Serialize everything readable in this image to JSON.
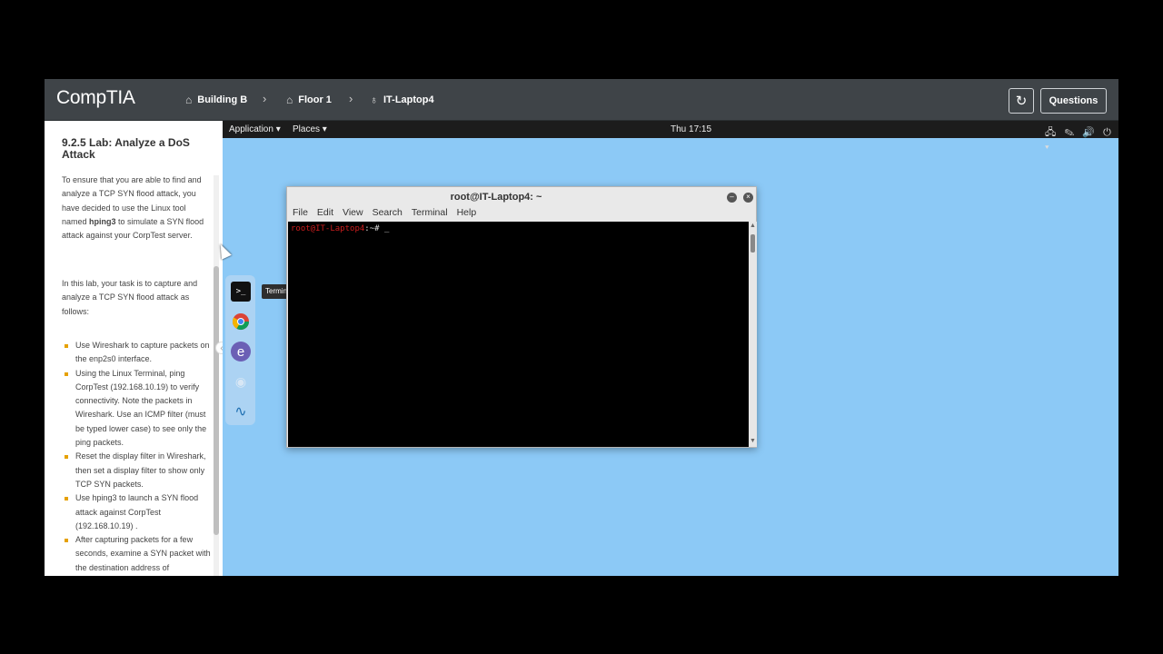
{
  "header": {
    "logo": "CompTIA",
    "breadcrumbs": [
      {
        "label": "Building B",
        "icon": "building-icon"
      },
      {
        "label": "Floor 1",
        "icon": "floor-icon"
      },
      {
        "label": "IT-Laptop4",
        "icon": "laptop-icon"
      }
    ],
    "separator": "›",
    "refresh_icon": "↻",
    "questions_label": "Questions"
  },
  "panel": {
    "title": "9.2.5 Lab: Analyze a DoS Attack",
    "intro_parts": [
      "To ensure that you are able to find and analyze a TCP SYN flood attack, you have decided to use the Linux tool named ",
      "hping3",
      " to simulate a SYN flood attack against your CorpTest server."
    ],
    "task_intro": "In this lab, your task is to capture and analyze a TCP SYN flood attack as follows:",
    "tasks": [
      "Use Wireshark to capture packets on the enp2s0 interface.",
      "Using the Linux Terminal, ping CorpTest (192.168.10.19) to verify connectivity. Note the packets in Wireshark. Use an ICMP filter (must be typed lower case) to see only the ping packets.",
      "Reset the display filter in Wireshark, then set a display filter to show only TCP SYN packets.",
      "Use hping3 to launch a SYN flood attack against CorpTest (192.168.10.19) .",
      "After capturing packets for a few seconds, examine a SYN packet with the destination address of"
    ]
  },
  "gnome": {
    "applications": "Application ▾",
    "places": "Places ▾",
    "clock": "Thu 17:15",
    "tray": "🖧 ✎ 🔊 ⏻ ▾"
  },
  "dock": {
    "tooltip": "Terminal",
    "items": [
      "terminal-icon",
      "chrome-icon",
      "emacs-icon",
      "eye-icon",
      "wireshark-icon"
    ]
  },
  "terminal": {
    "title": "root@IT-Laptop4: ~",
    "menu": [
      "File",
      "Edit",
      "View",
      "Search",
      "Terminal",
      "Help"
    ],
    "prompt_user": "root@IT-Laptop4",
    "prompt_rest": ":~# _"
  }
}
